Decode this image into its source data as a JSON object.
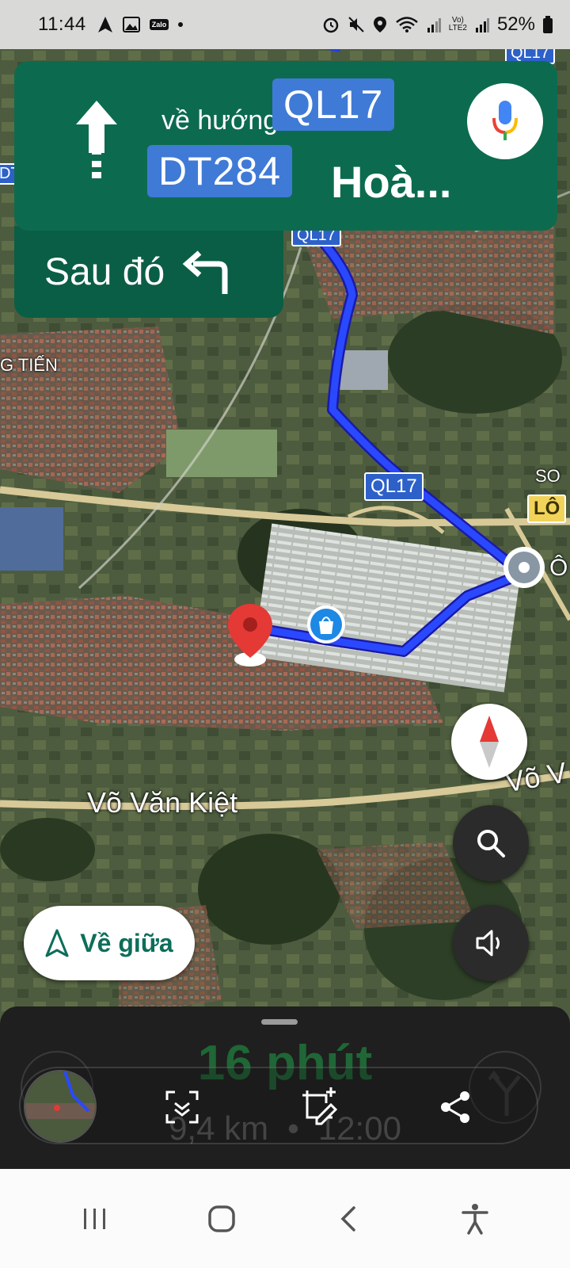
{
  "status_bar": {
    "time": "11:44",
    "zalo": "Zalo",
    "lte": "Vo)\nLTE2",
    "battery": "52%"
  },
  "map": {
    "places": [
      "G TIẾN",
      "SO",
      "Ô"
    ],
    "shields": {
      "ql17_top": "QL17",
      "ql17_route_top": "QL17",
      "ql17_route_mid": "QL17",
      "left_edge": "DT",
      "lo": "LÔ"
    },
    "streets": {
      "vo_van_kiet": "Võ Văn Kiệt",
      "vo_right": "Võ V"
    }
  },
  "navigation": {
    "toward_label": "về hướng",
    "route_1": "QL17",
    "route_2": "DT284",
    "destination": "Hoà...",
    "then_label": "Sau đó"
  },
  "controls": {
    "recenter_label": "Về giữa"
  },
  "trip": {
    "duration": "16 phút",
    "distance": "9,4 km",
    "separator": "•",
    "arrival": "12:00"
  },
  "colors": {
    "nav_green": "#0c6b4f",
    "shield_blue": "#3f7ad6",
    "route_blue": "#1f3ff0",
    "eta_green": "#1f7f3e"
  }
}
